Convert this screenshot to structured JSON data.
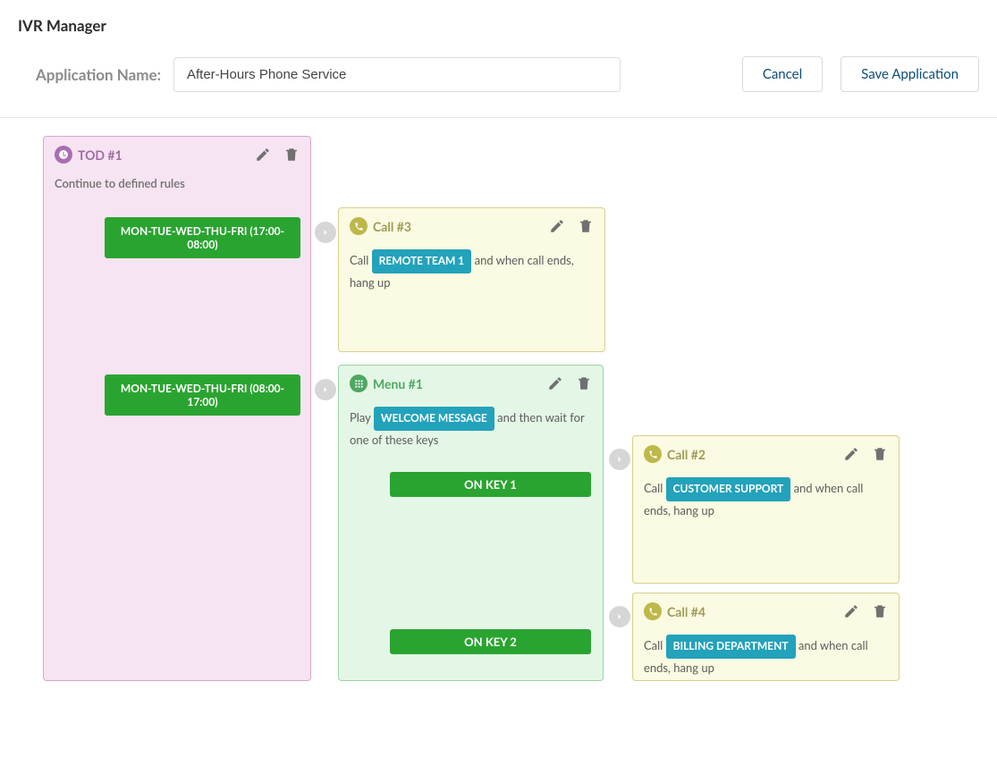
{
  "page_title": "IVR Manager",
  "app_name_label": "Application Name:",
  "app_name_value": "After-Hours Phone Service",
  "buttons": {
    "cancel": "Cancel",
    "save": "Save Application"
  },
  "tod": {
    "header": "TOD #1",
    "rules_hint": "Continue to defined rules",
    "rules": [
      "MON-TUE-WED-THU-FRI (17:00-08:00)",
      "MON-TUE-WED-THU-FRI (08:00-17:00)"
    ]
  },
  "call3": {
    "header": "Call #3",
    "prefix": "Call",
    "target": "REMOTE TEAM 1",
    "suffix": "and when call ends, hang up"
  },
  "menu1": {
    "header": "Menu #1",
    "prefix": "Play",
    "prompt": "WELCOME MESSAGE",
    "suffix": "and then wait for one of these keys",
    "keys": [
      "ON KEY 1",
      "ON KEY 2"
    ]
  },
  "call2": {
    "header": "Call #2",
    "prefix": "Call",
    "target": "CUSTOMER SUPPORT",
    "suffix": "and when call ends, hang up"
  },
  "call4": {
    "header": "Call #4",
    "prefix": "Call",
    "target": "BILLING DEPARTMENT",
    "suffix": "and when call ends, hang up"
  }
}
